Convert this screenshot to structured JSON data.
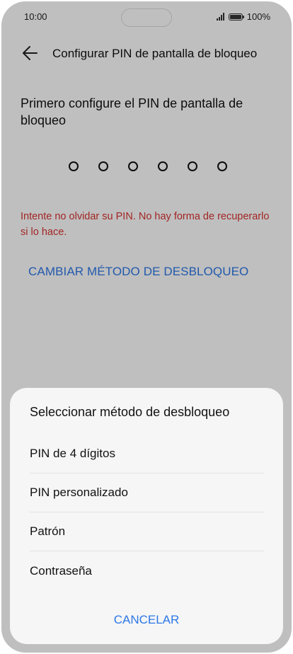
{
  "status_bar": {
    "time": "10:00",
    "battery_percent": "100%"
  },
  "header": {
    "title": "Configurar PIN de pantalla de bloqueo"
  },
  "main": {
    "prompt": "Primero configure el PIN de pantalla de bloqueo",
    "pin_length": 6,
    "warning": "Intente no olvidar su PIN. No hay forma de recuperarlo si lo hace.",
    "change_method_label": "CAMBIAR MÉTODO DE DESBLOQUEO"
  },
  "sheet": {
    "title": "Seleccionar método de desbloqueo",
    "options": [
      "PIN de 4 dígitos",
      "PIN personalizado",
      "Patrón",
      "Contraseña"
    ],
    "cancel_label": "CANCELAR"
  },
  "colors": {
    "accent": "#2d77e6",
    "warning": "#d83232"
  },
  "icons": {
    "back": "arrow-left-icon",
    "signal": "signal-icon",
    "battery": "battery-icon"
  }
}
